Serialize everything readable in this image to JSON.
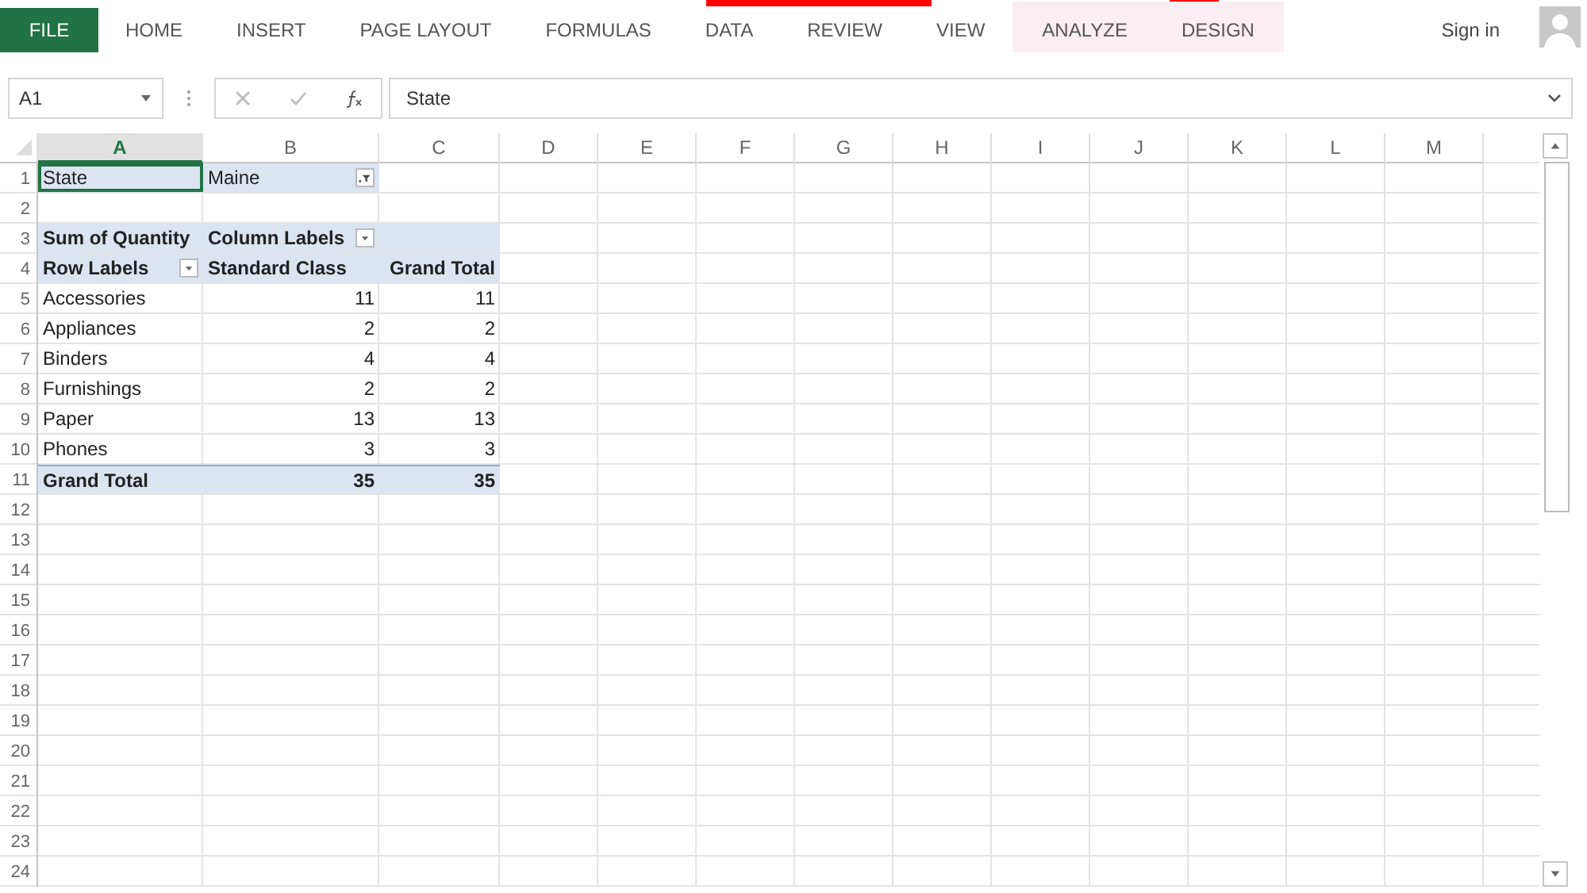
{
  "ribbon": {
    "tabs": [
      {
        "label": "FILE",
        "kind": "file"
      },
      {
        "label": "HOME",
        "kind": "normal"
      },
      {
        "label": "INSERT",
        "kind": "normal"
      },
      {
        "label": "PAGE LAYOUT",
        "kind": "normal"
      },
      {
        "label": "FORMULAS",
        "kind": "normal"
      },
      {
        "label": "DATA",
        "kind": "normal"
      },
      {
        "label": "REVIEW",
        "kind": "normal"
      },
      {
        "label": "VIEW",
        "kind": "normal"
      },
      {
        "label": "ANALYZE",
        "kind": "contextual"
      },
      {
        "label": "DESIGN",
        "kind": "contextual"
      }
    ],
    "account": {
      "label": "Sign in"
    }
  },
  "formula_bar": {
    "name_box": "A1",
    "value": "State"
  },
  "sheet": {
    "columns": [
      {
        "label": "A",
        "selected": true
      },
      {
        "label": "B",
        "selected": false
      },
      {
        "label": "C",
        "selected": false
      },
      {
        "label": "D",
        "selected": false
      },
      {
        "label": "E",
        "selected": false
      },
      {
        "label": "F",
        "selected": false
      },
      {
        "label": "G",
        "selected": false
      },
      {
        "label": "H",
        "selected": false
      },
      {
        "label": "I",
        "selected": false
      },
      {
        "label": "J",
        "selected": false
      },
      {
        "label": "K",
        "selected": false
      },
      {
        "label": "L",
        "selected": false
      },
      {
        "label": "M",
        "selected": false
      }
    ],
    "rows": [
      {
        "number": "1",
        "cells": [
          {
            "text": "State",
            "kind": "page",
            "selected": true
          },
          {
            "text": "Maine",
            "kind": "page",
            "selected": false,
            "dropdown": true,
            "filtered": true
          }
        ]
      },
      {
        "number": "2",
        "cells": []
      },
      {
        "number": "3",
        "cells": [
          {
            "text": "Sum of Quantity",
            "kind": "head"
          },
          {
            "text": "Column Labels",
            "kind": "head",
            "dropdown": true,
            "filtered": false
          },
          {
            "kind": "head"
          }
        ]
      },
      {
        "number": "4",
        "cells": [
          {
            "text": "Row Labels",
            "kind": "head",
            "dropdown": true,
            "filtered": false
          },
          {
            "text": "Standard Class",
            "kind": "head"
          },
          {
            "text": "Grand Total",
            "kind": "head-num"
          }
        ]
      },
      {
        "number": "5",
        "cells": [
          {
            "text": "Accessories",
            "kind": "item"
          },
          {
            "text": "11",
            "kind": "num"
          },
          {
            "text": "11",
            "kind": "num"
          }
        ]
      },
      {
        "number": "6",
        "cells": [
          {
            "text": "Appliances",
            "kind": "item"
          },
          {
            "text": "2",
            "kind": "num"
          },
          {
            "text": "2",
            "kind": "num"
          }
        ]
      },
      {
        "number": "7",
        "cells": [
          {
            "text": "Binders",
            "kind": "item"
          },
          {
            "text": "4",
            "kind": "num"
          },
          {
            "text": "4",
            "kind": "num"
          }
        ]
      },
      {
        "number": "8",
        "cells": [
          {
            "text": "Furnishings",
            "kind": "item"
          },
          {
            "text": "2",
            "kind": "num"
          },
          {
            "text": "2",
            "kind": "num"
          }
        ]
      },
      {
        "number": "9",
        "cells": [
          {
            "text": "Paper",
            "kind": "item"
          },
          {
            "text": "13",
            "kind": "num"
          },
          {
            "text": "13",
            "kind": "num"
          }
        ]
      },
      {
        "number": "10",
        "cells": [
          {
            "text": "Phones",
            "kind": "item"
          },
          {
            "text": "3",
            "kind": "num"
          },
          {
            "text": "3",
            "kind": "num"
          }
        ]
      },
      {
        "number": "11",
        "cells": [
          {
            "text": "Grand Total",
            "kind": "total"
          },
          {
            "text": "35",
            "kind": "total-num"
          },
          {
            "text": "35",
            "kind": "total-num"
          }
        ]
      },
      {
        "number": "12",
        "cells": []
      },
      {
        "number": "13",
        "cells": []
      },
      {
        "number": "14",
        "cells": []
      },
      {
        "number": "15",
        "cells": []
      },
      {
        "number": "16",
        "cells": []
      },
      {
        "number": "17",
        "cells": []
      },
      {
        "number": "18",
        "cells": []
      },
      {
        "number": "19",
        "cells": []
      },
      {
        "number": "20",
        "cells": []
      },
      {
        "number": "21",
        "cells": []
      },
      {
        "number": "22",
        "cells": []
      },
      {
        "number": "23",
        "cells": []
      },
      {
        "number": "24",
        "cells": []
      }
    ]
  }
}
